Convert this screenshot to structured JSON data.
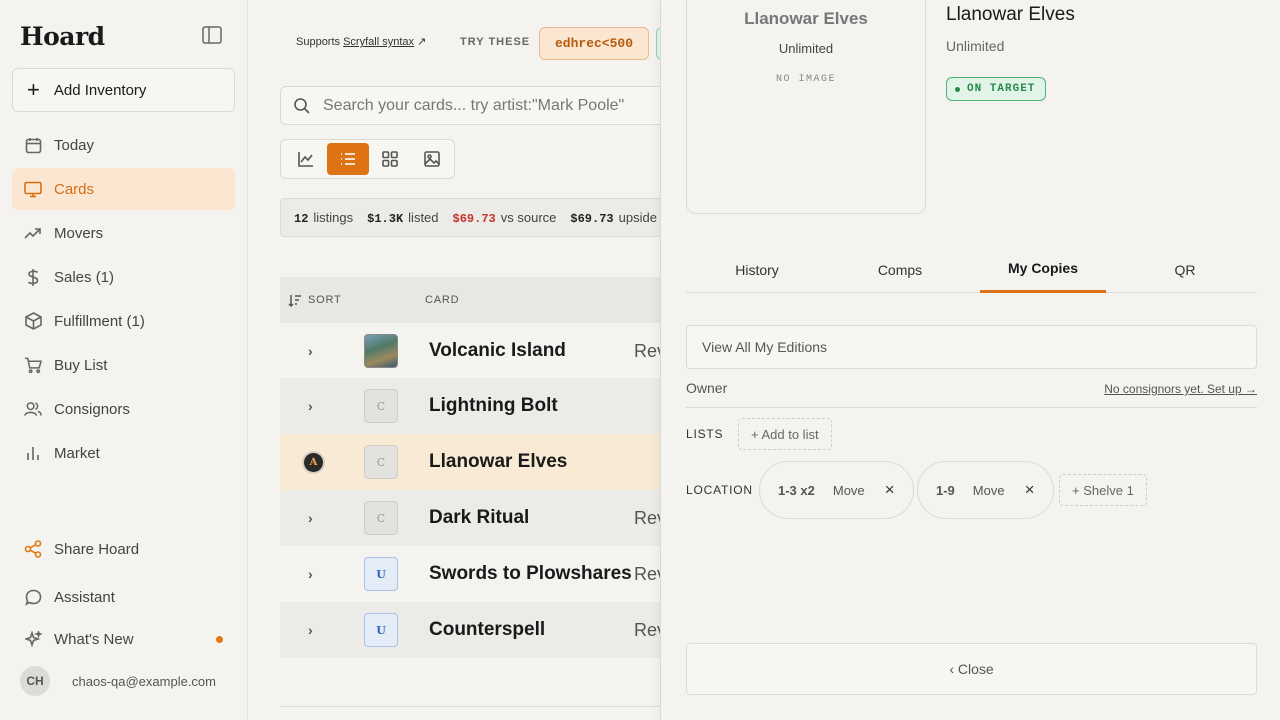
{
  "app": {
    "name": "Hoard"
  },
  "sidebar": {
    "add_inventory": "Add Inventory",
    "items": [
      {
        "label": "Today",
        "icon": "calendar-icon"
      },
      {
        "label": "Cards",
        "icon": "monitor-icon",
        "active": true
      },
      {
        "label": "Movers",
        "icon": "trending-up-icon"
      },
      {
        "label": "Sales (1)",
        "icon": "dollar-icon"
      },
      {
        "label": "Fulfillment (1)",
        "icon": "package-icon"
      },
      {
        "label": "Buy List",
        "icon": "cart-icon"
      },
      {
        "label": "Consignors",
        "icon": "users-icon"
      },
      {
        "label": "Market",
        "icon": "bar-chart-icon"
      }
    ],
    "share": "Share Hoard",
    "assistant": "Assistant",
    "whats_new": "What's New",
    "user": {
      "initials": "CH",
      "email": "chaos-qa@example.com"
    }
  },
  "search": {
    "supports_prefix": "Supports",
    "supports_link": "Scryfall syntax",
    "supports_arrow": "↗",
    "try_label": "TRY THESE",
    "try_chip": "edhrec<500",
    "placeholder": "Search your cards... try artist:\"Mark Poole\""
  },
  "stats": {
    "listings_count": "12",
    "listings_label": "listings",
    "listed_value": "$1.3K",
    "listed_label": "listed",
    "vs_source_value": "$69.73",
    "vs_source_label": "vs source",
    "upside_value": "$69.73",
    "upside_label": "upside"
  },
  "table": {
    "sort_label": "SORT",
    "card_col": "CARD",
    "rows": [
      {
        "name": "Volcanic Island",
        "rarity": "",
        "extra": "Rev"
      },
      {
        "name": "Lightning Bolt",
        "rarity": "C",
        "extra": ""
      },
      {
        "name": "Llanowar Elves",
        "rarity": "C",
        "extra": "",
        "badge": "A"
      },
      {
        "name": "Dark Ritual",
        "rarity": "C",
        "extra": "Rev"
      },
      {
        "name": "Swords to Plowshares",
        "rarity": "U",
        "extra": "Rev"
      },
      {
        "name": "Counterspell",
        "rarity": "U",
        "extra": "Rev"
      }
    ]
  },
  "detail": {
    "preview_name": "Llanowar Elves",
    "preview_set": "Unlimited",
    "preview_noimage": "NO IMAGE",
    "title": "Llanowar Elves",
    "set": "Unlimited",
    "status": "ON TARGET",
    "tabs": [
      "History",
      "Comps",
      "My Copies",
      "QR"
    ],
    "active_tab": "My Copies",
    "view_all": "View All My Editions",
    "owner_label": "Owner",
    "owner_link": "No consignors yet. Set up →",
    "lists_label": "LISTS",
    "add_to_list": "+ Add to list",
    "location_label": "LOCATION",
    "locations": [
      {
        "code": "1-3 x2",
        "move": "Move",
        "remove": "×"
      },
      {
        "code": "1-9",
        "move": "Move",
        "remove": "×"
      }
    ],
    "add_shelve": "+ Shelve 1",
    "close": "‹ Close"
  },
  "colors": {
    "accent": "#dd7312",
    "accent_bg": "#fbe6d1",
    "success": "#258a4a",
    "danger": "#c8322a"
  }
}
